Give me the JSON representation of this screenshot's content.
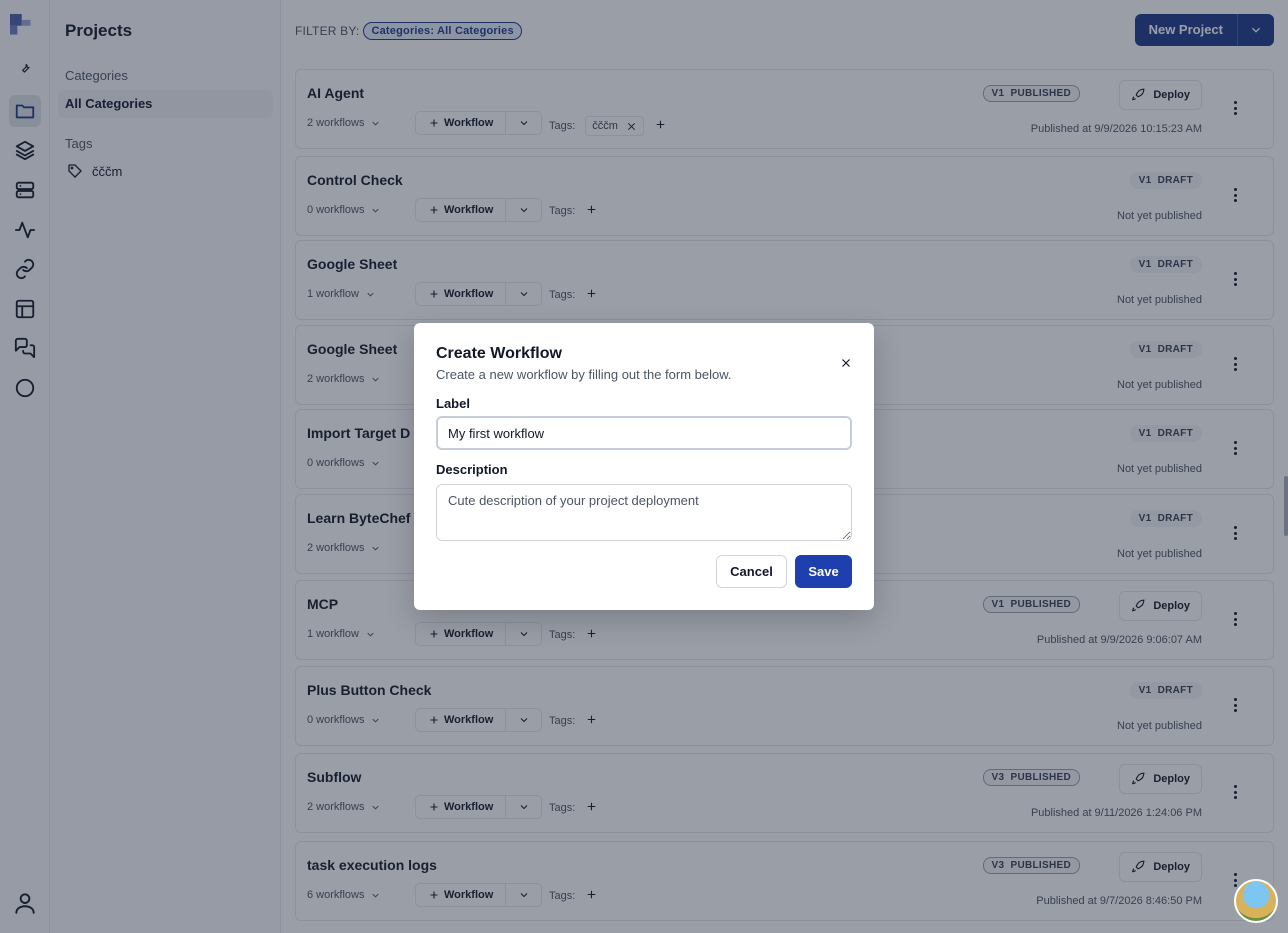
{
  "sidebar": {
    "title": "Projects",
    "categories_heading": "Categories",
    "all_categories": "All Categories",
    "tags_heading": "Tags",
    "tag_item": "čččm"
  },
  "header": {
    "filter_label": "FILTER BY:",
    "filter_chip": "Categories: All Categories",
    "new_project": "New Project"
  },
  "row_common": {
    "workflow_button": "Workflow",
    "tags_label": "Tags:",
    "deploy": "Deploy"
  },
  "projects": [
    {
      "name": "AI Agent",
      "workflows": "2 workflows",
      "version": "V1",
      "status": "PUBLISHED",
      "published": "Published at 9/9/2026 10:15:23 AM",
      "tag": "čččm"
    },
    {
      "name": "Control Check",
      "workflows": "0 workflows",
      "version": "V1",
      "status": "DRAFT",
      "published": "Not yet published"
    },
    {
      "name": "Google Sheet",
      "workflows": "1 workflow",
      "version": "V1",
      "status": "DRAFT",
      "published": "Not yet published"
    },
    {
      "name": "Google Sheet",
      "workflows": "2 workflows",
      "version": "V1",
      "status": "DRAFT",
      "published": "Not yet published"
    },
    {
      "name": "Import Target D",
      "workflows": "0 workflows",
      "version": "V1",
      "status": "DRAFT",
      "published": "Not yet published"
    },
    {
      "name": "Learn ByteChef",
      "workflows": "2 workflows",
      "version": "V1",
      "status": "DRAFT",
      "published": "Not yet published"
    },
    {
      "name": "MCP",
      "workflows": "1 workflow",
      "version": "V1",
      "status": "PUBLISHED",
      "published": "Published at 9/9/2026 9:06:07 AM"
    },
    {
      "name": "Plus Button Check",
      "workflows": "0 workflows",
      "version": "V1",
      "status": "DRAFT",
      "published": "Not yet published"
    },
    {
      "name": "Subflow",
      "workflows": "2 workflows",
      "version": "V3",
      "status": "PUBLISHED",
      "published": "Published at 9/11/2026 1:24:06 PM"
    },
    {
      "name": "task execution logs",
      "workflows": "6 workflows",
      "version": "V3",
      "status": "PUBLISHED",
      "published": "Published at 9/7/2026 8:46:50 PM"
    }
  ],
  "modal": {
    "title": "Create Workflow",
    "subtitle": "Create a new workflow by filling out the form below.",
    "label_label": "Label",
    "label_value": "My first workflow",
    "description_label": "Description",
    "description_placeholder": "Cute description of your project deployment",
    "cancel": "Cancel",
    "save": "Save"
  }
}
